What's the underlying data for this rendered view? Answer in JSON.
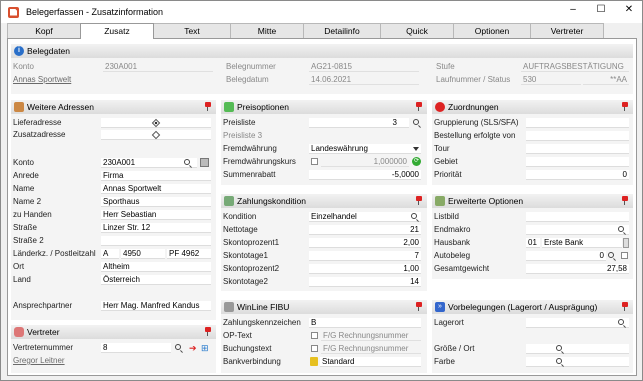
{
  "window": {
    "title": "Belegerfassen - Zusatzinformation",
    "min": "–",
    "max": "☐",
    "close": "✕"
  },
  "tabs": [
    "Kopf",
    "Zusatz",
    "Text",
    "Mitte",
    "Detailinfo",
    "Quick",
    "Optionen",
    "Vertreter"
  ],
  "belegdaten": {
    "title": "Belegdaten",
    "konto_label": "Konto",
    "konto": "230A001",
    "name_link": "Annas Sportwelt",
    "belegnummer_label": "Belegnummer",
    "belegnummer": "AG21-0815",
    "belegdatum_label": "Belegdatum",
    "belegdatum": "14.06.2021",
    "stufe_label": "Stufe",
    "stufe": "AUFTRAGSBESTÄTIGUNG",
    "laufnummer_label": "Laufnummer / Status",
    "laufnummer": "530",
    "status": "**AA"
  },
  "adressen": {
    "title": "Weitere Adressen",
    "lieferadresse": "Lieferadresse",
    "zusatzadresse": "Zusatzadresse",
    "konto_label": "Konto",
    "konto": "230A001",
    "anrede_label": "Anrede",
    "anrede": "Firma",
    "name_label": "Name",
    "name": "Annas Sportwelt",
    "name2_label": "Name 2",
    "name2": "Sporthaus",
    "zuhanden_label": "zu Handen",
    "zuhanden": "Herr Sebastian",
    "strasse_label": "Straße",
    "strasse": "Linzer Str. 12",
    "strasse2_label": "Straße 2",
    "laender_label": "Länderkz. / Postleitzahl",
    "laender": "A",
    "plz": "4950",
    "pf": "PF 4962",
    "ort_label": "Ort",
    "ort": "Altheim",
    "land_label": "Land",
    "land": "Österreich",
    "ansprech_label": "Ansprechpartner",
    "ansprech": "Herr Mag. Manfred Kandus"
  },
  "vertreter": {
    "title": "Vertreter",
    "nummer_label": "Vertreternummer",
    "nummer": "8",
    "name_link": "Gregor Leitner"
  },
  "preis": {
    "title": "Preisoptionen",
    "preisliste_label": "Preisliste",
    "preisliste": "3",
    "preisliste3": "Preisliste 3",
    "fremd_label": "Fremdwährung",
    "fremd": "Landeswährung",
    "kurs_label": "Fremdwährungskurs",
    "kurs": "1,000000",
    "rabatt_label": "Summenrabatt",
    "rabatt": "-5,0000"
  },
  "zahlung": {
    "title": "Zahlungskondition",
    "kondition_label": "Kondition",
    "kondition": "Einzelhandel",
    "netto_label": "Nettotage",
    "netto": "21",
    "sp1_label": "Skontoprozent1",
    "sp1": "2,00",
    "st1_label": "Skontotage1",
    "st1": "7",
    "sp2_label": "Skontoprozent2",
    "sp2": "1,00",
    "st2_label": "Skontotage2",
    "st2": "14"
  },
  "fibu": {
    "title": "WinLine FIBU",
    "zk_label": "Zahlungskennzeichen",
    "zk": "B",
    "op_label": "OP-Text",
    "op": "F/G Rechnungsnummer",
    "bt_label": "Buchungstext",
    "bt": "F/G Rechnungsnummer",
    "bank_label": "Bankverbindung",
    "bank": "Standard"
  },
  "zuordnungen": {
    "title": "Zuordnungen",
    "gruppierung": "Gruppierung (SLS/SFA)",
    "bestellung": "Bestellung erfolgte von",
    "tour": "Tour",
    "gebiet": "Gebiet",
    "prio_label": "Priorität",
    "prio": "0"
  },
  "erweitert": {
    "title": "Erweiterte Optionen",
    "listbild": "Listbild",
    "endmakro": "Endmakro",
    "hausbank_label": "Hausbank",
    "hausbank_nr": "01",
    "hausbank": "Erste Bank",
    "autobeleg_label": "Autobeleg",
    "autobeleg": "0",
    "gewicht_label": "Gesamtgewicht",
    "gewicht": "27,58"
  },
  "vorbelegungen": {
    "title": "Vorbelegungen (Lagerort / Ausprägung)",
    "lagerort": "Lagerort",
    "groesse": "Größe / Ort",
    "farbe": "Farbe"
  }
}
